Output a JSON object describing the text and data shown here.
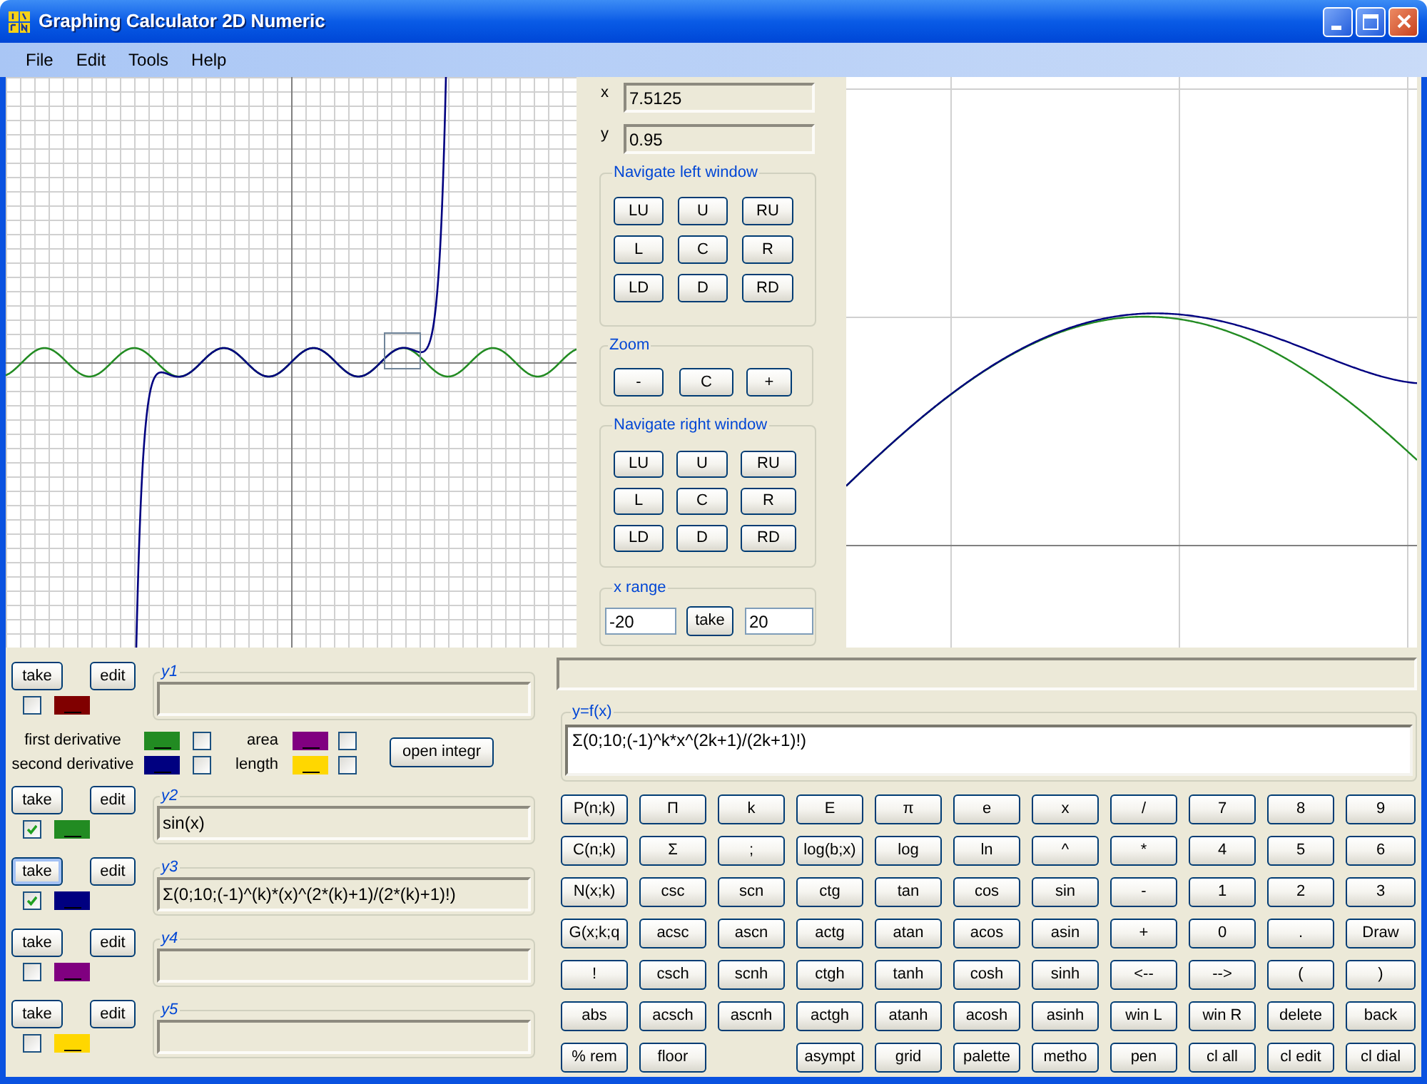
{
  "window": {
    "title": "Graphing Calculator 2D Numeric"
  },
  "menu": [
    "File",
    "Edit",
    "Tools",
    "Help"
  ],
  "cursor": [
    {
      "label": "x",
      "value": "7.5125"
    },
    {
      "label": "y",
      "value": "0.95"
    }
  ],
  "navigate_left_window": {
    "title": "Navigate left window",
    "buttons": [
      [
        "LU",
        "U",
        "RU"
      ],
      [
        "L",
        "C",
        "R"
      ],
      [
        "LD",
        "D",
        "RD"
      ]
    ]
  },
  "zoom": {
    "title": "Zoom",
    "buttons": [
      "-",
      "C",
      "+"
    ]
  },
  "navigate_right_window": {
    "title": "Navigate right window",
    "buttons": [
      [
        "LU",
        "U",
        "RU"
      ],
      [
        "L",
        "C",
        "R"
      ],
      [
        "LD",
        "D",
        "RD"
      ]
    ]
  },
  "x_range": {
    "title": "x range",
    "from": "-20",
    "button": "take",
    "to": "20"
  },
  "functions": [
    {
      "label": "y1",
      "take_button": "take",
      "edit_button": "edit",
      "take_focused": false,
      "checked": false,
      "color": "#800000"
    },
    {
      "label": "y2",
      "take_button": "take",
      "edit_button": "edit",
      "take_focused": false,
      "checked": true,
      "color": "#228b22",
      "value": "sin(x)"
    },
    {
      "label": "y3",
      "take_button": "take",
      "edit_button": "edit",
      "take_focused": true,
      "checked": true,
      "color": "#000080",
      "value": "Σ(0;10;(-1)^(k)*(x)^(2*(k)+1)/(2*(k)+1)!)"
    },
    {
      "label": "y4",
      "take_button": "take",
      "edit_button": "edit",
      "take_focused": false,
      "checked": false,
      "color": "#800080"
    },
    {
      "label": "y5",
      "take_button": "take",
      "edit_button": "edit",
      "take_focused": false,
      "checked": false,
      "color": "#ffd700"
    }
  ],
  "curve_options": [
    {
      "label": "first derivative",
      "color": "#228b22",
      "checked": false
    },
    {
      "label": "second derivative",
      "color": "#000080",
      "checked": false
    },
    {
      "label": "area",
      "color": "#800080",
      "checked": false
    },
    {
      "label": "length",
      "color": "#ffd700",
      "checked": false
    }
  ],
  "integral_button": "open integr",
  "expression": {
    "label": "y=f(x)",
    "value": "Σ(0;10;(-1)^k*x^(2k+1)/(2k+1)!)"
  },
  "keypad": [
    [
      {
        "kind": "key",
        "label": "P(n;k)"
      },
      {
        "kind": "key",
        "label": "Π"
      },
      {
        "kind": "key",
        "label": "k"
      },
      {
        "kind": "key",
        "label": "E"
      },
      {
        "kind": "key",
        "label": "π"
      },
      {
        "kind": "key",
        "label": "e"
      },
      {
        "kind": "key",
        "label": "x"
      },
      {
        "kind": "key",
        "label": "/"
      },
      {
        "kind": "key",
        "label": "7"
      },
      {
        "kind": "key",
        "label": "8"
      },
      {
        "kind": "key",
        "label": "9"
      }
    ],
    [
      {
        "kind": "key",
        "label": "C(n;k)"
      },
      {
        "kind": "key",
        "label": "Σ"
      },
      {
        "kind": "key",
        "label": ";"
      },
      {
        "kind": "key",
        "label": "log(b;x)"
      },
      {
        "kind": "key",
        "label": "log"
      },
      {
        "kind": "key",
        "label": "ln"
      },
      {
        "kind": "key",
        "label": "^"
      },
      {
        "kind": "key",
        "label": "*"
      },
      {
        "kind": "key",
        "label": "4"
      },
      {
        "kind": "key",
        "label": "5"
      },
      {
        "kind": "key",
        "label": "6"
      }
    ],
    [
      {
        "kind": "key",
        "label": "N(x;k)"
      },
      {
        "kind": "key",
        "label": "csc"
      },
      {
        "kind": "key",
        "label": "scn"
      },
      {
        "kind": "key",
        "label": "ctg"
      },
      {
        "kind": "key",
        "label": "tan"
      },
      {
        "kind": "key",
        "label": "cos"
      },
      {
        "kind": "key",
        "label": "sin"
      },
      {
        "kind": "key",
        "label": "-"
      },
      {
        "kind": "key",
        "label": "1"
      },
      {
        "kind": "key",
        "label": "2"
      },
      {
        "kind": "key",
        "label": "3"
      }
    ],
    [
      {
        "kind": "key",
        "label": "G(x;k;q"
      },
      {
        "kind": "key",
        "label": "acsc"
      },
      {
        "kind": "key",
        "label": "ascn"
      },
      {
        "kind": "key",
        "label": "actg"
      },
      {
        "kind": "key",
        "label": "atan"
      },
      {
        "kind": "key",
        "label": "acos"
      },
      {
        "kind": "key",
        "label": "asin"
      },
      {
        "kind": "key",
        "label": "+"
      },
      {
        "kind": "key",
        "label": "0"
      },
      {
        "kind": "key",
        "label": "."
      },
      {
        "kind": "key",
        "label": "Draw"
      }
    ],
    [
      {
        "kind": "key",
        "label": "!"
      },
      {
        "kind": "key",
        "label": "csch"
      },
      {
        "kind": "key",
        "label": "scnh"
      },
      {
        "kind": "key",
        "label": "ctgh"
      },
      {
        "kind": "key",
        "label": "tanh"
      },
      {
        "kind": "key",
        "label": "cosh"
      },
      {
        "kind": "key",
        "label": "sinh"
      },
      {
        "kind": "key",
        "label": "<--"
      },
      {
        "kind": "key",
        "label": "-->"
      },
      {
        "kind": "key",
        "label": "("
      },
      {
        "kind": "key",
        "label": ")"
      }
    ],
    [
      {
        "kind": "key",
        "label": "abs"
      },
      {
        "kind": "key",
        "label": "acsch"
      },
      {
        "kind": "key",
        "label": "ascnh"
      },
      {
        "kind": "key",
        "label": "actgh"
      },
      {
        "kind": "key",
        "label": "atanh"
      },
      {
        "kind": "key",
        "label": "acosh"
      },
      {
        "kind": "key",
        "label": "asinh"
      },
      {
        "kind": "key",
        "label": "win L"
      },
      {
        "kind": "key",
        "label": "win R"
      },
      {
        "kind": "key",
        "label": "delete"
      },
      {
        "kind": "key",
        "label": "back"
      }
    ],
    [
      {
        "kind": "key",
        "label": "% rem"
      },
      {
        "kind": "key",
        "label": "floor"
      },
      {
        "kind": "spacer"
      },
      {
        "kind": "key",
        "label": "asympt"
      },
      {
        "kind": "key",
        "label": "grid"
      },
      {
        "kind": "key",
        "label": "palette"
      },
      {
        "kind": "key",
        "label": "metho"
      },
      {
        "kind": "key",
        "label": "pen"
      },
      {
        "kind": "key",
        "label": "cl all"
      },
      {
        "kind": "key",
        "label": "cl edit"
      },
      {
        "kind": "key",
        "label": "cl dial"
      }
    ]
  ]
}
